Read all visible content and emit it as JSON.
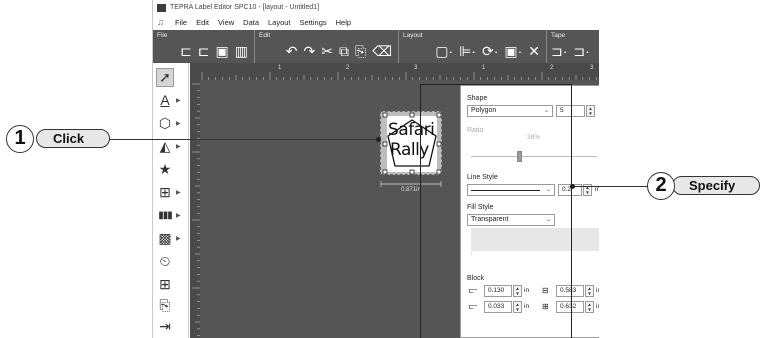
{
  "window": {
    "title": "TEPRA Label Editor SPC10 - [layout - Untitled1]"
  },
  "menu": [
    "File",
    "Edit",
    "View",
    "Data",
    "Layout",
    "Settings",
    "Help"
  ],
  "ribbon": {
    "sections": [
      {
        "label": "File",
        "icons": [
          "new-label-icon",
          "open-icon",
          "save-icon",
          "book-icon"
        ],
        "glyphs": [
          "⊏",
          "⊏",
          "▣",
          "▥"
        ]
      },
      {
        "label": "Edit",
        "icons": [
          "undo-icon",
          "redo-icon",
          "cut-icon",
          "copy-icon",
          "paste-icon",
          "delete-icon"
        ],
        "glyphs": [
          "↶",
          "↷",
          "✂",
          "⧉",
          "⎘",
          "🗑"
        ]
      },
      {
        "label": "Layout",
        "icons": [
          "frame-icon",
          "align-icon",
          "rotate-icon",
          "arrange-icon",
          "flip-icon"
        ],
        "glyphs": [
          "▢·",
          "⊫·",
          "⟳·",
          "▣·",
          "✕"
        ]
      },
      {
        "label": "Tape",
        "icons": [
          "tape-feed-icon",
          "tape-cut-icon"
        ],
        "glyphs": [
          "⊐·",
          "⊐·"
        ]
      }
    ]
  },
  "tools": [
    {
      "icon": "select-arrow-icon",
      "glyph": "➚",
      "selected": true,
      "submenu": false
    },
    {
      "icon": "text-icon",
      "glyph": "A̲",
      "selected": false,
      "submenu": true
    },
    {
      "icon": "shape-icon",
      "glyph": "⬡",
      "selected": false,
      "submenu": true
    },
    {
      "icon": "image-icon",
      "glyph": "▲",
      "selected": false,
      "submenu": true
    },
    {
      "icon": "symbol-icon",
      "glyph": "★",
      "selected": false,
      "submenu": false
    },
    {
      "icon": "frame-tool-icon",
      "glyph": "⊞",
      "selected": false,
      "submenu": true
    },
    {
      "icon": "barcode-icon",
      "glyph": "▮▮▮",
      "selected": false,
      "submenu": true
    },
    {
      "icon": "qr-code-icon",
      "glyph": "▩",
      "selected": false,
      "submenu": true
    },
    {
      "icon": "date-time-icon",
      "glyph": "⏲",
      "selected": false,
      "submenu": false
    },
    {
      "icon": "table-icon",
      "glyph": "⊞",
      "selected": false,
      "submenu": false
    },
    {
      "icon": "serial-number-icon",
      "glyph": "⎘",
      "selected": false,
      "submenu": false
    },
    {
      "icon": "import-icon",
      "glyph": "⇥",
      "selected": false,
      "submenu": false
    }
  ],
  "canvas": {
    "ruler_numbers": [
      "1",
      "2",
      "3",
      "1",
      "2",
      "3"
    ],
    "shape_text_line1": "Safari",
    "shape_text_line2": "Rally",
    "dimension_label": "0.871in"
  },
  "panel": {
    "shape_label": "Shape",
    "shape_value": "Polygon",
    "sides_value": "5",
    "ratio_label": "Ratio",
    "ratio_value": "38%",
    "ratio_fraction": 0.38,
    "line_style_label": "Line Style",
    "line_width_value": "0.2",
    "line_unit": "in",
    "fill_style_label": "Fill Style",
    "fill_value": "Transparent",
    "block_label": "Block",
    "block_x": "0.130",
    "block_y": "0.033",
    "block_w": "0.583",
    "block_h": "0.632",
    "unit": "in"
  },
  "callouts": {
    "one_number": "1",
    "one_label": "Click",
    "two_number": "2",
    "two_label": "Specify"
  },
  "colors": {
    "ribbon": "#555555",
    "canvas": "#555555",
    "callout_fill": "#e8e8e8"
  }
}
